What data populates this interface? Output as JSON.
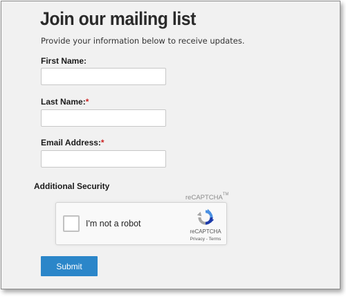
{
  "form": {
    "title": "Join our mailing list",
    "subtitle": "Provide your information below to receive updates.",
    "fields": [
      {
        "label": "First Name:",
        "required": false,
        "value": "",
        "placeholder": ""
      },
      {
        "label": "Last Name:",
        "required": true,
        "value": "",
        "placeholder": ""
      },
      {
        "label": "Email Address:",
        "required": true,
        "value": "",
        "placeholder": ""
      }
    ],
    "required_marker": "*",
    "security_label": "Additional Security",
    "submit_label": "Submit"
  },
  "recaptcha": {
    "header": "reCAPTCHA",
    "trademark": "TM",
    "checkbox_label": "I'm not a robot",
    "checked": false,
    "brand": "reCAPTCHA",
    "privacy_label": "Privacy",
    "separator": " - ",
    "terms_label": "Terms",
    "logo_icon": "recaptcha-logo-icon"
  },
  "colors": {
    "panel_background": "#f1f1f1",
    "required_marker": "#cc2222",
    "submit_button": "#2b86c9",
    "recaptcha_blue": "#4a90e2",
    "recaptcha_dark_blue": "#1c3aa9",
    "recaptcha_gray": "#a6a6a6"
  }
}
